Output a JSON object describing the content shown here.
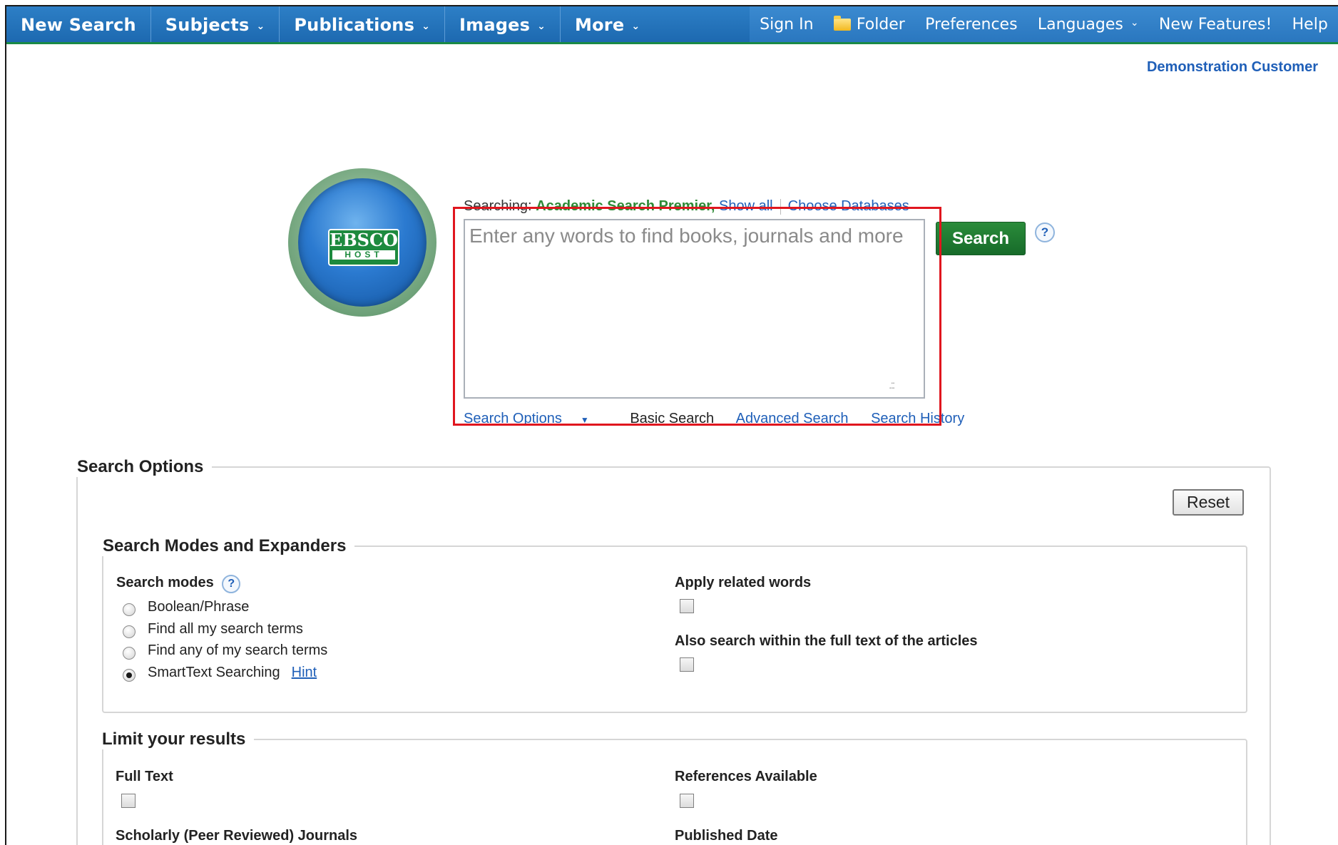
{
  "nav": {
    "left": [
      {
        "label": "New Search",
        "dropdown": false
      },
      {
        "label": "Subjects",
        "dropdown": true
      },
      {
        "label": "Publications",
        "dropdown": true
      },
      {
        "label": "Images",
        "dropdown": true
      },
      {
        "label": "More",
        "dropdown": true
      }
    ],
    "right": {
      "sign_in": "Sign In",
      "folder": "Folder",
      "preferences": "Preferences",
      "languages": "Languages",
      "new_features": "New Features!",
      "help": "Help"
    }
  },
  "customer": "Demonstration Customer",
  "logo": {
    "line1": "EBSCO",
    "line2": "HOST"
  },
  "searching": {
    "prefix": "Searching:",
    "database": "Academic Search Premier,",
    "show_all": "Show all",
    "choose_databases": "Choose Databases"
  },
  "search": {
    "placeholder": "Enter any words to find books, journals and more",
    "value": "",
    "button": "Search",
    "help_icon": "?"
  },
  "search_links": {
    "options": "Search Options",
    "basic": "Basic Search",
    "advanced": "Advanced Search",
    "history": "Search History"
  },
  "options_panel": {
    "title": "Search Options",
    "reset": "Reset",
    "modes_section": {
      "title": "Search Modes and Expanders",
      "search_modes_label": "Search modes",
      "help_icon": "?",
      "modes": [
        {
          "label": "Boolean/Phrase",
          "selected": false
        },
        {
          "label": "Find all my search terms",
          "selected": false
        },
        {
          "label": "Find any of my search terms",
          "selected": false
        },
        {
          "label": "SmartText Searching",
          "selected": true
        }
      ],
      "hint": "Hint",
      "apply_related": {
        "label": "Apply related words",
        "checked": false
      },
      "full_text_search": {
        "label": "Also search within the full text of the articles",
        "checked": false
      }
    },
    "limit_section": {
      "title": "Limit your results",
      "full_text": {
        "label": "Full Text",
        "checked": false
      },
      "references": {
        "label": "References Available",
        "checked": false
      },
      "scholarly": {
        "label": "Scholarly (Peer Reviewed) Journals"
      },
      "published_date": {
        "label": "Published Date"
      }
    }
  },
  "colors": {
    "nav_blue": "#1d69b0",
    "nav_accent_green": "#1a8a46",
    "search_button_green": "#176b2a",
    "link_blue": "#1f5fb8",
    "highlight_red": "#e0161e"
  }
}
